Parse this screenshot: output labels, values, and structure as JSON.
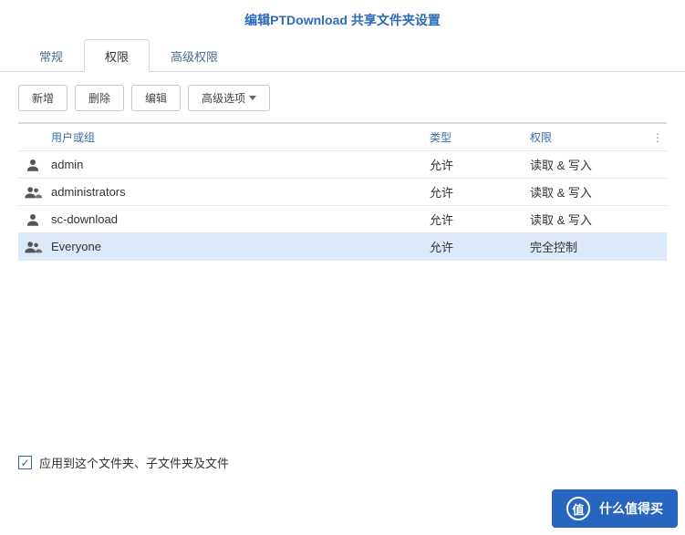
{
  "header": {
    "title": "编辑PTDownload 共享文件夹设置"
  },
  "tabs": [
    {
      "label": "常规",
      "active": false
    },
    {
      "label": "权限",
      "active": true
    },
    {
      "label": "高级权限",
      "active": false
    }
  ],
  "toolbar": {
    "add": "新增",
    "delete": "删除",
    "edit": "编辑",
    "advanced": "高级选项"
  },
  "grid": {
    "headers": {
      "name": "用户或组",
      "type": "类型",
      "perm": "权限"
    },
    "rows": [
      {
        "icon": "user",
        "name": "admin",
        "type": "允许",
        "perm": "读取 & 写入",
        "selected": false
      },
      {
        "icon": "group",
        "name": "administrators",
        "type": "允许",
        "perm": "读取 & 写入",
        "selected": false
      },
      {
        "icon": "user",
        "name": "sc-download",
        "type": "允许",
        "perm": "读取 & 写入",
        "selected": false
      },
      {
        "icon": "group",
        "name": "Everyone",
        "type": "允许",
        "perm": "完全控制",
        "selected": true
      }
    ]
  },
  "footer": {
    "checkbox_label": "应用到这个文件夹、子文件夹及文件",
    "checked": true
  },
  "watermark": {
    "badge": "值",
    "text": "什么值得买"
  }
}
